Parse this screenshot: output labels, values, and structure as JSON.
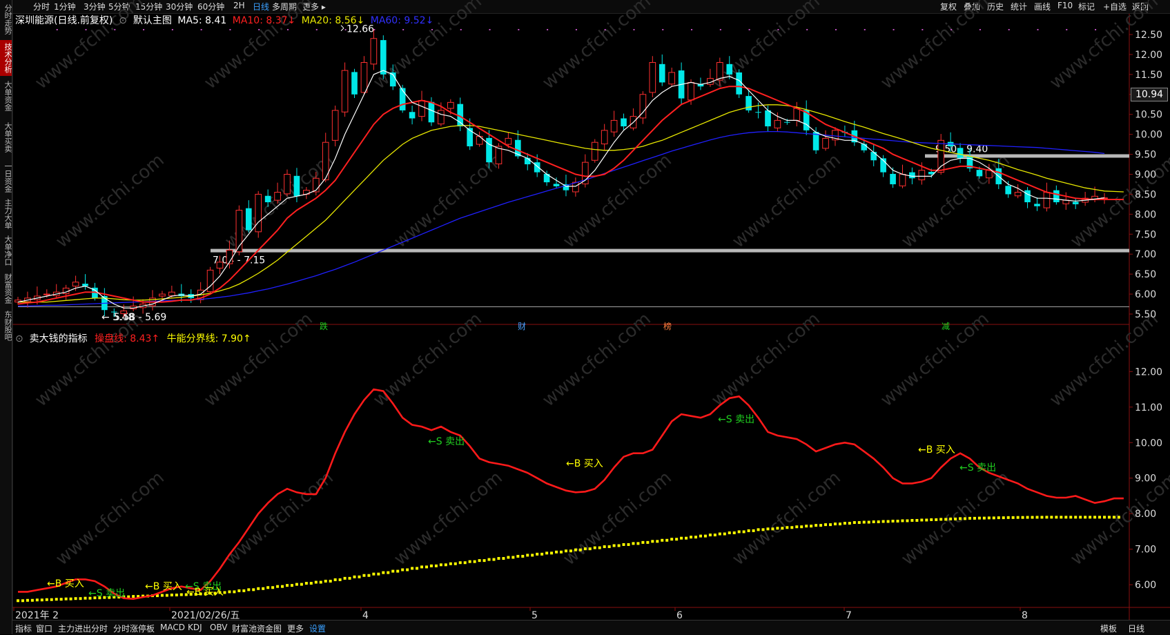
{
  "left_tabs": [
    {
      "label": "分时走势",
      "active": false
    },
    {
      "label": "技术分析",
      "active": true
    },
    {
      "label": "大单资金",
      "active": false
    },
    {
      "label": "大单买卖",
      "active": false
    },
    {
      "label": "一日资金",
      "active": false
    },
    {
      "label": "主力大单",
      "active": false
    },
    {
      "label": "大单净口",
      "active": false
    },
    {
      "label": "财富资金",
      "active": false
    },
    {
      "label": "东财股吧",
      "active": false
    }
  ],
  "toolbar": {
    "periods": [
      "分时",
      "1分钟",
      "3分钟",
      "5分钟",
      "15分钟",
      "30分钟",
      "60分钟",
      "2H",
      "日线",
      "多周期",
      "更多 ▸"
    ],
    "active_period": "日线",
    "right_buttons": [
      "复权",
      "叠加",
      "历史",
      "统计",
      "画线",
      "F10",
      "标记",
      "+自选",
      "返回"
    ]
  },
  "main_legend": {
    "stock": "深圳能源(日线.前复权)",
    "template": "默认主图",
    "ma5": "MA5: 8.41",
    "ma10": "MA10: 8.37↓",
    "ma20": "MA20: 8.56↓",
    "ma60": "MA60: 9.52↓"
  },
  "indicator_legend": {
    "name": "卖大钱的指标",
    "line1": "操盘线: 8.43↑",
    "line2": "牛能分界线: 7.90↑"
  },
  "price_axis": [
    "12.50",
    "12.00",
    "11.50",
    "11.00",
    "10.50",
    "10.00",
    "9.50",
    "9.00",
    "8.50",
    "8.00",
    "7.50",
    "7.00",
    "6.50",
    "6.00",
    "5.50"
  ],
  "current_price": "10.94",
  "indicator_axis": [
    "12.00",
    "11.00",
    "10.00",
    "9.00",
    "8.00",
    "7.00",
    "6.00"
  ],
  "x_labels": [
    "2021年 2",
    "2021/02/26/五",
    "4",
    "5",
    "6",
    "7",
    "8"
  ],
  "bottom_bar": {
    "items": [
      "指标",
      "窗口",
      "主力进出分时",
      "分时涨停板",
      "MACD",
      "KDJ",
      "OBV",
      "财富池资金图",
      "更多",
      "设置"
    ],
    "highlight": "设置",
    "right": [
      "模板",
      "日线"
    ]
  },
  "annotations": {
    "high": "12.66",
    "low": "5.48",
    "band_upper": "9.50 - 9.40",
    "band_lower": "7.04 - 7.15",
    "band_bottom": "5.58 - 5.69",
    "event_markers": [
      "跌",
      "财",
      "榜",
      "减"
    ]
  },
  "signals": [
    {
      "text": "←B 买入",
      "type": "buy"
    },
    {
      "text": "←S 卖出",
      "type": "sell"
    },
    {
      "text": "←B 买入",
      "type": "buy"
    },
    {
      "text": "←S 卖出",
      "type": "sell"
    },
    {
      "text": "←B 买入",
      "type": "buy"
    },
    {
      "text": "←S 卖出",
      "type": "sell"
    },
    {
      "text": "←B 买入",
      "type": "buy"
    },
    {
      "text": "←S 卖出",
      "type": "sell"
    },
    {
      "text": "←B 买入",
      "type": "buy"
    },
    {
      "text": "←S 卖出",
      "type": "sell"
    }
  ],
  "watermark": "www.cfchi.com",
  "colors": {
    "up": "#ff3030",
    "down": "#00e8e8",
    "ma5": "#ffffff",
    "ma10": "#ff2020",
    "ma20": "#e8e800",
    "ma60": "#2020ff",
    "op_line": "#ff1a1a",
    "bull_line": "#ffff00",
    "buy": "#ffff00",
    "sell": "#20d020"
  },
  "chart_data": [
    {
      "type": "candlestick",
      "title": "深圳能源(日线.前复权)",
      "ylim": [
        5.4,
        12.75
      ],
      "close": [
        5.85,
        5.9,
        5.95,
        6.0,
        6.05,
        6.15,
        6.3,
        6.2,
        5.9,
        5.6,
        5.55,
        5.58,
        5.7,
        5.75,
        5.9,
        6.0,
        6.05,
        5.95,
        5.9,
        6.1,
        6.6,
        6.8,
        7.1,
        8.1,
        7.6,
        8.5,
        8.3,
        8.55,
        9.0,
        8.45,
        8.6,
        8.9,
        9.8,
        10.6,
        11.6,
        11.0,
        11.8,
        12.4,
        11.5,
        11.2,
        10.6,
        10.4,
        10.85,
        10.3,
        10.6,
        10.8,
        10.2,
        9.7,
        9.95,
        9.3,
        9.7,
        9.9,
        9.45,
        9.25,
        9.05,
        8.8,
        8.7,
        8.6,
        8.8,
        9.3,
        9.8,
        10.1,
        10.35,
        10.2,
        10.45,
        11.0,
        11.8,
        11.3,
        11.55,
        10.9,
        11.3,
        11.2,
        11.4,
        11.8,
        11.5,
        11.0,
        10.6,
        10.55,
        10.2,
        10.35,
        10.3,
        10.65,
        10.1,
        9.6,
        9.9,
        10.1,
        10.05,
        9.8,
        9.6,
        9.35,
        9.05,
        8.75,
        9.0,
        8.9,
        9.1,
        9.0,
        9.85,
        9.7,
        9.4,
        9.15,
        8.95,
        9.1,
        8.75,
        8.5,
        8.55,
        8.3,
        8.2,
        8.55,
        8.3,
        8.35,
        8.25,
        8.4,
        8.45,
        8.41
      ],
      "ma5": [
        5.8,
        5.85,
        5.9,
        5.95,
        6.0,
        6.05,
        6.15,
        6.2,
        6.1,
        5.9,
        5.75,
        5.65,
        5.65,
        5.7,
        5.75,
        5.85,
        5.95,
        5.98,
        5.95,
        6.0,
        6.2,
        6.45,
        6.8,
        7.2,
        7.5,
        7.8,
        8.0,
        8.2,
        8.4,
        8.45,
        8.5,
        8.6,
        8.9,
        9.4,
        10.0,
        10.5,
        11.0,
        11.5,
        11.6,
        11.5,
        11.1,
        10.8,
        10.7,
        10.6,
        10.5,
        10.45,
        10.3,
        10.1,
        9.95,
        9.75,
        9.65,
        9.6,
        9.5,
        9.4,
        9.2,
        9.0,
        8.85,
        8.7,
        8.7,
        8.85,
        9.1,
        9.45,
        9.8,
        10.1,
        10.3,
        10.55,
        10.85,
        11.05,
        11.2,
        11.25,
        11.3,
        11.25,
        11.3,
        11.4,
        11.45,
        11.35,
        11.1,
        10.85,
        10.6,
        10.45,
        10.35,
        10.35,
        10.25,
        10.05,
        9.95,
        9.9,
        9.85,
        9.85,
        9.75,
        9.55,
        9.35,
        9.1,
        9.0,
        8.95,
        8.95,
        8.95,
        9.2,
        9.35,
        9.4,
        9.4,
        9.3,
        9.15,
        8.95,
        8.75,
        8.65,
        8.5,
        8.4,
        8.4,
        8.38,
        8.35,
        8.33,
        8.35,
        8.38,
        8.41
      ],
      "ma10": [
        5.75,
        5.78,
        5.8,
        5.85,
        5.9,
        5.95,
        6.0,
        6.05,
        6.05,
        6.0,
        5.95,
        5.9,
        5.85,
        5.8,
        5.8,
        5.8,
        5.82,
        5.85,
        5.85,
        5.9,
        6.0,
        6.15,
        6.35,
        6.6,
        6.85,
        7.1,
        7.35,
        7.6,
        7.9,
        8.1,
        8.25,
        8.4,
        8.6,
        8.85,
        9.2,
        9.55,
        9.9,
        10.25,
        10.5,
        10.65,
        10.75,
        10.8,
        10.85,
        10.8,
        10.7,
        10.55,
        10.45,
        10.3,
        10.15,
        10.0,
        9.85,
        9.7,
        9.6,
        9.5,
        9.4,
        9.3,
        9.2,
        9.1,
        9.0,
        8.95,
        8.95,
        9.0,
        9.15,
        9.35,
        9.6,
        9.85,
        10.1,
        10.35,
        10.55,
        10.75,
        10.85,
        10.95,
        11.05,
        11.15,
        11.2,
        11.2,
        11.15,
        11.05,
        10.95,
        10.85,
        10.75,
        10.65,
        10.55,
        10.4,
        10.25,
        10.15,
        10.05,
        9.95,
        9.85,
        9.75,
        9.65,
        9.5,
        9.4,
        9.3,
        9.2,
        9.1,
        9.1,
        9.15,
        9.2,
        9.2,
        9.15,
        9.1,
        9.05,
        8.95,
        8.85,
        8.75,
        8.65,
        8.55,
        8.5,
        8.45,
        8.4,
        8.38,
        8.37,
        8.37,
        8.37,
        8.37
      ],
      "ma20": [
        5.8,
        5.8,
        5.8,
        5.8,
        5.82,
        5.84,
        5.86,
        5.88,
        5.9,
        5.9,
        5.88,
        5.86,
        5.85,
        5.85,
        5.86,
        5.88,
        5.9,
        5.92,
        5.95,
        5.98,
        6.02,
        6.08,
        6.15,
        6.25,
        6.38,
        6.52,
        6.68,
        6.85,
        7.05,
        7.25,
        7.45,
        7.65,
        7.85,
        8.1,
        8.35,
        8.6,
        8.85,
        9.1,
        9.35,
        9.55,
        9.75,
        9.9,
        10.0,
        10.1,
        10.15,
        10.2,
        10.22,
        10.22,
        10.2,
        10.15,
        10.1,
        10.05,
        10.0,
        9.95,
        9.9,
        9.85,
        9.8,
        9.75,
        9.7,
        9.65,
        9.62,
        9.6,
        9.6,
        9.62,
        9.65,
        9.7,
        9.78,
        9.85,
        9.95,
        10.05,
        10.15,
        10.25,
        10.35,
        10.45,
        10.55,
        10.62,
        10.68,
        10.72,
        10.74,
        10.74,
        10.72,
        10.68,
        10.62,
        10.55,
        10.48,
        10.4,
        10.32,
        10.25,
        10.18,
        10.1,
        10.02,
        9.95,
        9.88,
        9.8,
        9.72,
        9.65,
        9.6,
        9.55,
        9.5,
        9.45,
        9.4,
        9.35,
        9.28,
        9.2,
        9.12,
        9.05,
        8.98,
        8.9,
        8.84,
        8.78,
        8.72,
        8.66,
        8.62,
        8.58,
        8.57,
        8.56
      ],
      "ma60": [
        5.7,
        5.7,
        5.71,
        5.72,
        5.72,
        5.73,
        5.74,
        5.75,
        5.76,
        5.77,
        5.78,
        5.79,
        5.8,
        5.81,
        5.82,
        5.83,
        5.84,
        5.85,
        5.86,
        5.87,
        5.89,
        5.92,
        5.95,
        5.99,
        6.03,
        6.08,
        6.13,
        6.19,
        6.25,
        6.32,
        6.39,
        6.46,
        6.54,
        6.62,
        6.71,
        6.8,
        6.9,
        7.0,
        7.1,
        7.2,
        7.3,
        7.4,
        7.5,
        7.6,
        7.7,
        7.8,
        7.9,
        7.98,
        8.06,
        8.14,
        8.22,
        8.3,
        8.37,
        8.44,
        8.51,
        8.58,
        8.65,
        8.72,
        8.79,
        8.86,
        8.94,
        9.02,
        9.1,
        9.18,
        9.26,
        9.34,
        9.42,
        9.5,
        9.58,
        9.65,
        9.72,
        9.79,
        9.86,
        9.92,
        9.97,
        10.01,
        10.04,
        10.06,
        10.07,
        10.07,
        10.06,
        10.04,
        10.02,
        10.0,
        9.98,
        9.96,
        9.94,
        9.92,
        9.9,
        9.88,
        9.86,
        9.84,
        9.82,
        9.8,
        9.79,
        9.78,
        9.77,
        9.76,
        9.75,
        9.74,
        9.73,
        9.72,
        9.71,
        9.7,
        9.69,
        9.68,
        9.67,
        9.65,
        9.63,
        9.61,
        9.59,
        9.57,
        9.55,
        9.52
      ],
      "levels": [
        {
          "label": "9.50 - 9.40",
          "value": 9.45
        },
        {
          "label": "7.04 - 7.15",
          "value": 7.08
        },
        {
          "label": "5.58 - 5.69",
          "value": 5.64
        }
      ]
    },
    {
      "type": "line",
      "title": "卖大钱的指标",
      "ylim": [
        5.4,
        12.9
      ],
      "series": [
        {
          "name": "操盘线",
          "values": [
            5.8,
            5.8,
            5.85,
            5.9,
            5.95,
            6.05,
            6.15,
            6.15,
            6.1,
            5.95,
            5.75,
            5.62,
            5.6,
            5.65,
            5.7,
            5.8,
            5.9,
            5.95,
            5.9,
            5.85,
            6.1,
            6.45,
            6.85,
            7.2,
            7.6,
            8.0,
            8.3,
            8.55,
            8.7,
            8.6,
            8.55,
            8.55,
            9.0,
            9.7,
            10.3,
            10.8,
            11.2,
            11.5,
            11.45,
            11.1,
            10.7,
            10.5,
            10.45,
            10.35,
            10.45,
            10.3,
            10.2,
            9.9,
            9.55,
            9.45,
            9.4,
            9.35,
            9.25,
            9.15,
            9.0,
            8.85,
            8.75,
            8.65,
            8.6,
            8.62,
            8.7,
            8.95,
            9.3,
            9.6,
            9.7,
            9.7,
            9.8,
            10.2,
            10.6,
            10.8,
            10.75,
            10.7,
            10.8,
            11.05,
            11.25,
            11.3,
            11.05,
            10.7,
            10.3,
            10.2,
            10.15,
            10.1,
            9.95,
            9.75,
            9.85,
            9.95,
            10.0,
            9.95,
            9.75,
            9.55,
            9.3,
            9.0,
            8.85,
            8.85,
            8.9,
            9.0,
            9.3,
            9.55,
            9.7,
            9.55,
            9.3,
            9.15,
            9.05,
            8.95,
            8.85,
            8.7,
            8.6,
            8.5,
            8.45,
            8.45,
            8.5,
            8.4,
            8.3,
            8.35,
            8.43,
            8.43
          ]
        },
        {
          "name": "牛能分界线",
          "values": [
            5.55,
            5.56,
            5.57,
            5.58,
            5.59,
            5.6,
            5.61,
            5.62,
            5.63,
            5.64,
            5.65,
            5.66,
            5.67,
            5.68,
            5.69,
            5.7,
            5.71,
            5.72,
            5.73,
            5.74,
            5.76,
            5.78,
            5.8,
            5.83,
            5.86,
            5.89,
            5.92,
            5.95,
            5.98,
            6.01,
            6.04,
            6.07,
            6.1,
            6.14,
            6.18,
            6.22,
            6.26,
            6.3,
            6.34,
            6.38,
            6.42,
            6.46,
            6.5,
            6.53,
            6.56,
            6.59,
            6.62,
            6.65,
            6.68,
            6.71,
            6.74,
            6.77,
            6.8,
            6.83,
            6.86,
            6.89,
            6.92,
            6.95,
            6.98,
            7.01,
            7.04,
            7.07,
            7.1,
            7.13,
            7.16,
            7.19,
            7.22,
            7.25,
            7.28,
            7.31,
            7.34,
            7.37,
            7.4,
            7.43,
            7.46,
            7.49,
            7.52,
            7.55,
            7.57,
            7.59,
            7.61,
            7.63,
            7.65,
            7.67,
            7.69,
            7.71,
            7.73,
            7.75,
            7.76,
            7.77,
            7.78,
            7.79,
            7.8,
            7.81,
            7.82,
            7.83,
            7.84,
            7.85,
            7.86,
            7.87,
            7.875,
            7.88,
            7.885,
            7.89,
            7.893,
            7.896,
            7.898,
            7.9,
            7.9,
            7.9,
            7.9,
            7.9,
            7.9,
            7.9,
            7.9
          ]
        }
      ]
    }
  ]
}
